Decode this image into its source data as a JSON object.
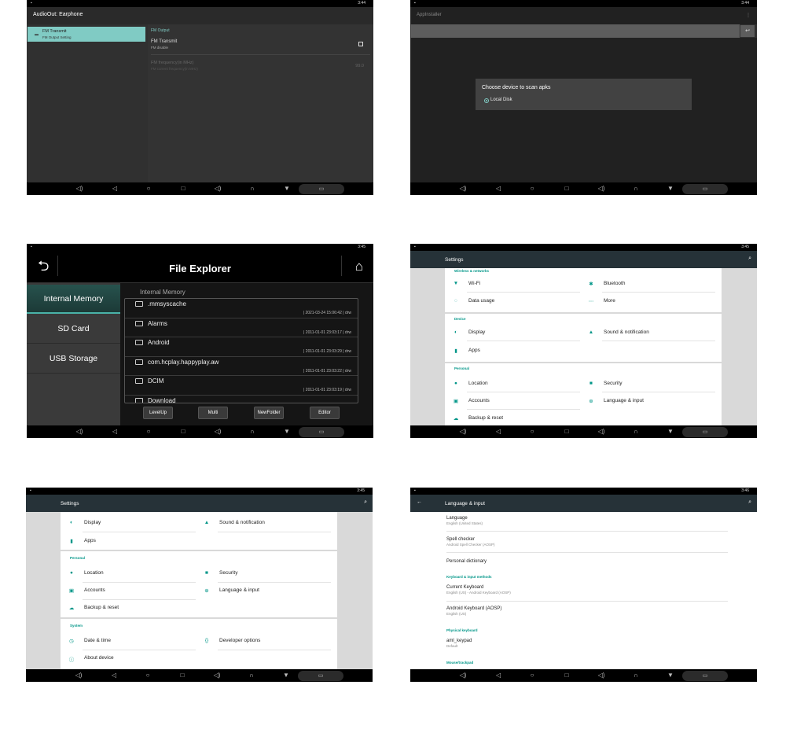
{
  "status_times": [
    "3:44",
    "3:44",
    "3:45",
    "3:45",
    "3:45",
    "3:46"
  ],
  "nav_icons": [
    "volume-down-icon",
    "back-icon",
    "home-icon",
    "recents-icon",
    "volume-up-icon",
    "headphones-icon",
    "menu-down-icon",
    "screen-icon"
  ],
  "accent_color": "#009688",
  "fm_screen": {
    "title": "AudioOut: Earphone",
    "side_item": {
      "title": "FM Transmit",
      "subtitle": "FM Output Setting"
    },
    "section": "FM Output",
    "transmit": {
      "title": "FM Transmit",
      "subtitle": "FM disable",
      "checked": false
    },
    "frequency": {
      "title": "FM frequency(in MHz)",
      "subtitle": "FM current frequency(in MHz)",
      "value": "99.0"
    }
  },
  "appinstaller_screen": {
    "title": "AppInstaller",
    "menu_icon": "more-vert-icon",
    "clear_icon": "clear-icon",
    "dialog": {
      "title": "Choose device to scan apks",
      "option": "Local Disk",
      "selected": true
    }
  },
  "file_explorer": {
    "title": "File Explorer",
    "tabs": [
      "Internal Memory",
      "SD Card",
      "USB Storage"
    ],
    "active_tab": 0,
    "path": "Internal Memory",
    "files": [
      {
        "name": ".mmsyscache",
        "meta": "| 2021-03-24 15:06:42 | drw"
      },
      {
        "name": "Alarms",
        "meta": "| 2011-01-01 23:03:17 | drw"
      },
      {
        "name": "Android",
        "meta": "| 2011-01-01 23:03:29 | drw"
      },
      {
        "name": "com.hcplay.happyplay.aw",
        "meta": "| 2011-01-01 23:03:22 | drw"
      },
      {
        "name": "DCIM",
        "meta": "| 2011-01-01 23:03:19 | drw"
      },
      {
        "name": "Download",
        "meta": ""
      }
    ],
    "buttons": [
      "LevelUp",
      "Multi",
      "NewFolder",
      "Editor"
    ]
  },
  "settings_a": {
    "title": "Settings",
    "sections": [
      {
        "name": "Wireless & networks",
        "items": [
          [
            "Wi-Fi",
            "Bluetooth"
          ],
          [
            "Data usage",
            "More"
          ]
        ]
      },
      {
        "name": "Device",
        "items": [
          [
            "Display",
            "Sound & notification"
          ],
          [
            "Apps",
            ""
          ]
        ]
      },
      {
        "name": "Personal",
        "items": [
          [
            "Location",
            "Security"
          ],
          [
            "Accounts",
            "Language & input"
          ],
          [
            "Backup & reset",
            ""
          ]
        ]
      }
    ]
  },
  "settings_b": {
    "title": "Settings",
    "device_items": [
      [
        "Display",
        "Sound & notification"
      ],
      [
        "Apps",
        ""
      ]
    ],
    "personal_header": "Personal",
    "personal_items": [
      [
        "Location",
        "Security"
      ],
      [
        "Accounts",
        "Language & input"
      ],
      [
        "Backup & reset",
        ""
      ]
    ],
    "system_header": "System",
    "system_items": [
      [
        "Date & time",
        "Developer options"
      ],
      [
        "About device",
        ""
      ]
    ]
  },
  "language_input": {
    "title": "Language & input",
    "items": [
      {
        "type": "item",
        "title": "Language",
        "subtitle": "English (United States)"
      },
      {
        "type": "item",
        "title": "Spell checker",
        "subtitle": "Android Spell Checker (AOSP)"
      },
      {
        "type": "item",
        "title": "Personal dictionary",
        "subtitle": ""
      },
      {
        "type": "cat",
        "title": "Keyboard & input methods"
      },
      {
        "type": "item",
        "title": "Current Keyboard",
        "subtitle": "English (US) - Android Keyboard (AOSP)"
      },
      {
        "type": "item",
        "title": "Android Keyboard (AOSP)",
        "subtitle": "English (US)"
      },
      {
        "type": "cat",
        "title": "Physical keyboard"
      },
      {
        "type": "item",
        "title": "aml_keypad",
        "subtitle": "Default"
      },
      {
        "type": "cat",
        "title": "Mouse/trackpad"
      }
    ]
  }
}
